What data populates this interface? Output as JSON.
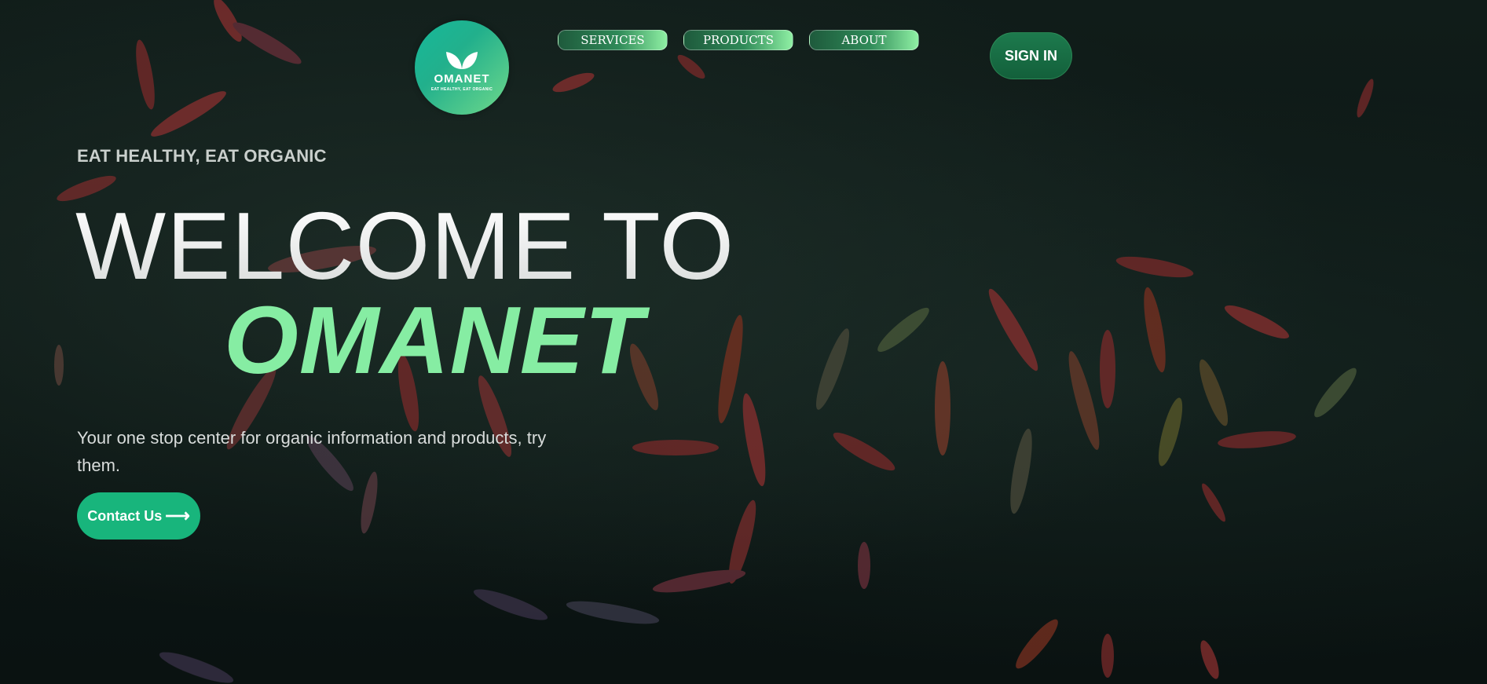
{
  "brand": {
    "name": "OMANET",
    "tagline": "EAT HEALTHY, EAT ORGANIC",
    "logo_icon": "leaf-icon",
    "accent_color": "#86eda3",
    "button_color": "#18b57c"
  },
  "nav": {
    "items": [
      {
        "label": "SERVICES"
      },
      {
        "label": "PRODUCTS"
      },
      {
        "label": "ABOUT"
      }
    ],
    "signin_label": "SIGN IN"
  },
  "hero": {
    "eyebrow": "EAT HEALTHY, EAT ORGANIC",
    "headline_line1": "WELCOME TO",
    "headline_line2": "OMANET",
    "subtext": "Your one stop center for organic information and products, try them.",
    "cta_label": "Contact Us",
    "cta_icon": "arrow-right-icon",
    "cta_arrow": "⟶",
    "background": "dark grass with red and green leaves spelling a word"
  }
}
